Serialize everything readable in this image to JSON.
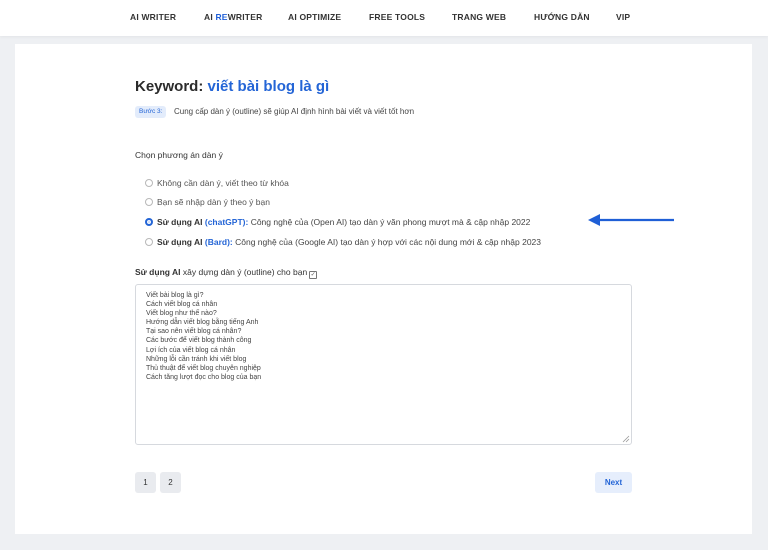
{
  "nav": {
    "ai_writer": "AI WRITER",
    "ai_rewriter_prefix": "AI ",
    "ai_rewriter_highlight": "RE",
    "ai_rewriter_suffix": "WRITER",
    "ai_optimize": "AI OPTIMIZE",
    "free_tools": "FREE TOOLS",
    "trang_web": "TRANG WEB",
    "huong_dan": "HƯỚNG DẪN",
    "vip": "VIP"
  },
  "keyword": {
    "label": "Keyword: ",
    "value": "viết bài blog là gì"
  },
  "step": {
    "badge": "Bước 3:",
    "text": "Cung cấp dàn ý (outline) sẽ giúp AI định hình bài viết và viết tốt hơn"
  },
  "outline_options": {
    "heading": "Chọn phương án dàn ý",
    "options": [
      {
        "label": "Không cần dàn ý, viết theo từ khóa"
      },
      {
        "label": "Bạn sẽ nhập dàn ý theo ý bạn"
      },
      {
        "prefix": "Sử dụng AI ",
        "highlight": "(chatGPT):",
        "desc": " Công nghệ của (Open AI) tạo dàn ý văn phong mượt mà & cập nhập 2022"
      },
      {
        "prefix": "Sử dụng AI ",
        "highlight": "(Bard):",
        "desc": " Công nghệ của (Google AI) tạo dàn ý hợp với các nội dung mới & cập nhập 2023"
      }
    ],
    "selected_index": 2
  },
  "ai_outline": {
    "label_bold": "Sử dụng AI",
    "label_rest": " xây dựng dàn ý (outline) cho bạn",
    "checkbox_icon": "check-square-icon",
    "lines": [
      "Viết bài blog là gì?",
      "Cách viết blog cá nhân",
      "Viết blog như thế nào?",
      "Hướng dẫn viết blog bằng tiếng Anh",
      "Tại sao nên viết blog cá nhân?",
      "Các bước để viết blog thành công",
      "Lợi ích của viết blog cá nhân",
      "Những lỗi cần tránh khi viết blog",
      "Thủ thuật để viết blog chuyên nghiệp",
      "Cách tăng lượt đọc cho blog của bạn"
    ]
  },
  "pagination": {
    "pages": [
      "1",
      "2"
    ],
    "next_label": "Next"
  },
  "colors": {
    "accent": "#2465d6",
    "background": "#eef0f3",
    "arrow": "#1f5fd6"
  }
}
